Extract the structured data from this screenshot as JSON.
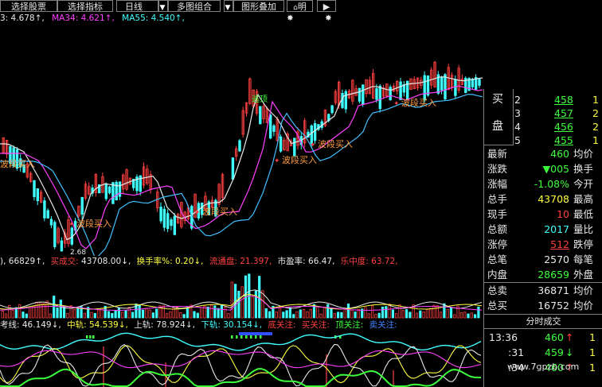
{
  "toolbar": {
    "buttons": [
      "选择股票",
      "选择指标",
      "日线",
      "多图组合",
      "图形叠加",
      "明",
      "▶"
    ]
  },
  "ma_line": {
    "ma1": "3: 4.678↑,",
    "ma2": "MA34: 4.621↑,",
    "ma3": "MA55: 4.540↑,"
  },
  "chart_annotations": {
    "buy_signal": "波段买入",
    "up_label": "逃顶",
    "low_price": "2.68"
  },
  "volume_line": {
    "vol": "), 66829↑,",
    "trade_vol_label": "买成交:",
    "trade_vol_value": "43708.00↓,",
    "turnover": "换手率%: 0.20↓,",
    "float_cap": "流通盘: 21.397,",
    "pe": "市盈率: 66.47,",
    "trust": "乐中度: 63.72,"
  },
  "indicator_line": {
    "ref": "考线: 46.149↓,",
    "mid": "中轨: 54.539↓,",
    "upper": "上轨: 78.924↓,",
    "lower": "下轨: 30.154↓,",
    "bottom_watch": "底关注:",
    "buy_watch": "买关注:",
    "top_watch": "顶关注:",
    "sell_watch": "卖关注:"
  },
  "quote_panel": {
    "buy_side_label_1": "买",
    "buy_side_label_2": "盘",
    "bids": [
      {
        "level": "2",
        "price": "458",
        "qty": "1"
      },
      {
        "level": "3",
        "price": "457",
        "qty": "2"
      },
      {
        "level": "4",
        "price": "456",
        "qty": "2"
      },
      {
        "level": "5",
        "price": "455",
        "qty": "1"
      }
    ],
    "stats": [
      {
        "label": "最新",
        "value": "460",
        "cut": "均价"
      },
      {
        "label": "涨跌",
        "value": "▼005",
        "cut": "换手"
      },
      {
        "label": "涨幅",
        "value": "-1.08%",
        "cut": "今开"
      },
      {
        "label": "总手",
        "value": "43708",
        "cut": "最高"
      },
      {
        "label": "现手",
        "value": "10",
        "cut": "最低"
      },
      {
        "label": "总额",
        "value": "2017",
        "cut": "量比"
      },
      {
        "label": "涨停",
        "value": "512",
        "cut": "跌停"
      },
      {
        "label": "总笔",
        "value": "2570",
        "cut": "每笔"
      },
      {
        "label": "内盘",
        "value": "28659",
        "cut": "外盘"
      },
      {
        "label": "总卖",
        "value": "36871",
        "cut": "均价"
      },
      {
        "label": "总买",
        "value": "16752",
        "cut": "均价"
      }
    ],
    "tick_header": "分时成交",
    "ticks": [
      {
        "time": "13:36",
        "price": "460",
        "dir": "↑",
        "vol": "1"
      },
      {
        "time": ":31",
        "price": "459",
        "dir": "↓",
        "vol": "1"
      },
      {
        "time": ":34",
        "price": "460",
        "dir": "↑",
        "vol": "1"
      }
    ]
  },
  "watermark": "www.7gpzb.com",
  "colors": {
    "up": "#ff4040",
    "down": "#40ffff",
    "price": "#3cff3c",
    "label": "#ffff40"
  }
}
